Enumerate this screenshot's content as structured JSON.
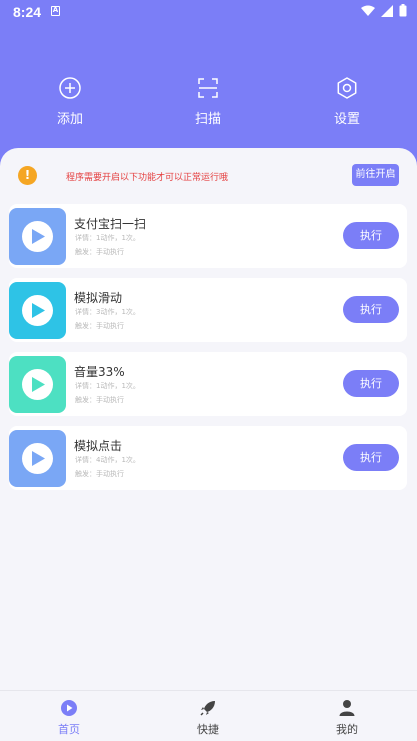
{
  "status_bar": {
    "time": "8:24",
    "notif_icon": "a-icon",
    "icons": [
      "wifi-icon",
      "signal-icon",
      "battery-icon"
    ]
  },
  "top_actions": [
    {
      "label": "添加",
      "icon": "plus-circle-icon"
    },
    {
      "label": "扫描",
      "icon": "scan-icon"
    },
    {
      "label": "设置",
      "icon": "gear-icon"
    }
  ],
  "notice": {
    "text": "程序需要开启以下功能才可以正常运行哦",
    "button": "前往开启",
    "icon": "warning-icon"
  },
  "tasks": [
    {
      "title": "支付宝扫一扫",
      "detail": "详情：1动作，1次。",
      "trigger": "触发：手动执行",
      "button": "执行",
      "color": "#7aa7f5"
    },
    {
      "title": "模拟滑动",
      "detail": "详情：3动作，1次。",
      "trigger": "触发：手动执行",
      "button": "执行",
      "color": "#2ec3e6"
    },
    {
      "title": "音量33%",
      "detail": "详情：1动作，1次。",
      "trigger": "触发：手动执行",
      "button": "执行",
      "color": "#4de0c2"
    },
    {
      "title": "模拟点击",
      "detail": "详情：4动作，1次。",
      "trigger": "触发：手动执行",
      "button": "执行",
      "color": "#7aa7f5"
    }
  ],
  "tabs": [
    {
      "label": "首页",
      "icon": "home-play-icon",
      "active": true
    },
    {
      "label": "快捷",
      "icon": "rocket-icon",
      "active": false
    },
    {
      "label": "我的",
      "icon": "user-icon",
      "active": false
    }
  ],
  "colors": {
    "accent": "#7b7ef7",
    "background": "#f5f5fa",
    "warning": "#f5a623",
    "notice_text": "#e54040"
  }
}
